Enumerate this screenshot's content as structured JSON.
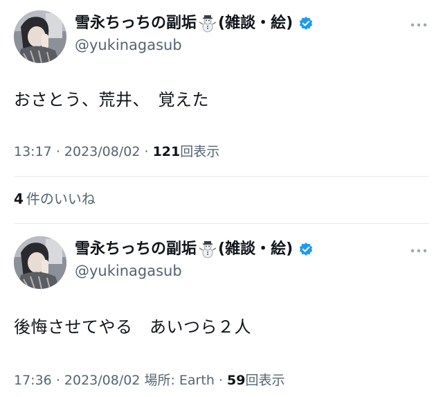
{
  "tweets": [
    {
      "display_name": "雪永ちっちの副垢",
      "name_suffix": "(雑談・絵)",
      "name_emoji_icon": "snowman-icon",
      "verified_icon": "verified-badge-icon",
      "verified_color": "#1d9bf0",
      "handle": "@yukinagasub",
      "text": "おさとう、荒井、　覚えた",
      "time": "13:17",
      "separator": "·",
      "date": "2023/08/02",
      "view_count": "121",
      "view_label": "回表示",
      "like_count": "4",
      "like_label": "件のいいね"
    },
    {
      "display_name": "雪永ちっちの副垢",
      "name_suffix": "(雑談・絵)",
      "name_emoji_icon": "snowman-icon",
      "verified_icon": "verified-badge-icon",
      "verified_color": "#1d9bf0",
      "handle": "@yukinagasub",
      "text": "後悔させてやる　あいつら２人",
      "time": "17:36",
      "separator": "·",
      "date": "2023/08/02",
      "location": "場所: Earth",
      "view_count": "59",
      "view_label": "回表示"
    }
  ],
  "colors": {
    "text_primary": "#0f1419",
    "text_secondary": "#536471",
    "divider": "#e6e9eb"
  }
}
